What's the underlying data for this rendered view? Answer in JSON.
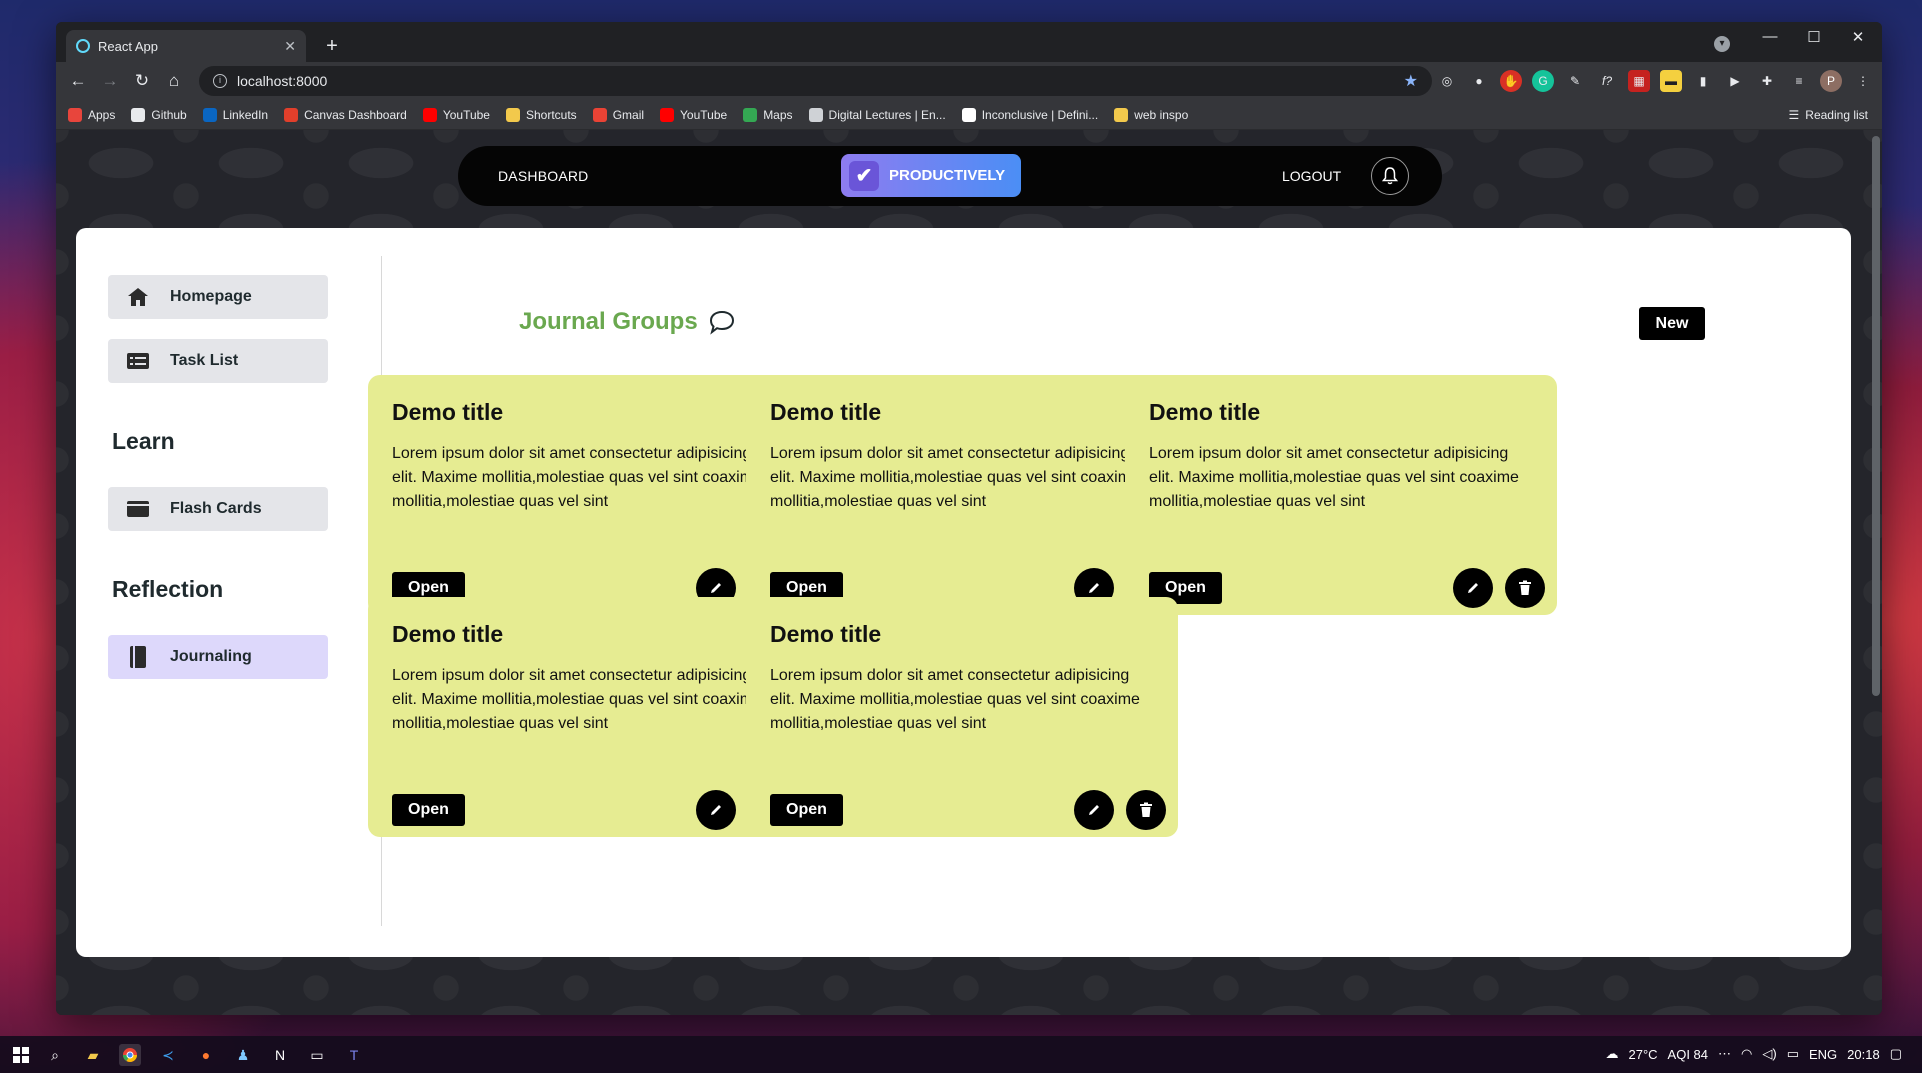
{
  "browser": {
    "tab_title": "React App",
    "new_tab_label": "+",
    "url": "localhost:8000",
    "bookmarks": [
      {
        "label": "Apps",
        "color": "#e8453c"
      },
      {
        "label": "Github",
        "color": "#e8eaed"
      },
      {
        "label": "LinkedIn",
        "color": "#0a66c2"
      },
      {
        "label": "Canvas Dashboard",
        "color": "#e13f2b"
      },
      {
        "label": "YouTube",
        "color": "#ff0000"
      },
      {
        "label": "Shortcuts",
        "color": "#f2c94c"
      },
      {
        "label": "Gmail",
        "color": "#ea4335"
      },
      {
        "label": "YouTube",
        "color": "#ff0000"
      },
      {
        "label": "Maps",
        "color": "#34a853"
      },
      {
        "label": "Digital Lectures | En...",
        "color": "#cfd2d6"
      },
      {
        "label": "Inconclusive | Defini...",
        "color": "#ffffff"
      },
      {
        "label": "web inspo",
        "color": "#f2c94c"
      }
    ],
    "reading_list": "Reading list",
    "profile_initial": "P"
  },
  "nav": {
    "dashboard": "DASHBOARD",
    "brand": "PRODUCTIVELY",
    "logout": "LOGOUT"
  },
  "sidebar": {
    "items": [
      {
        "label": "Homepage",
        "icon": "home-icon"
      },
      {
        "label": "Task List",
        "icon": "list-icon"
      }
    ],
    "learn_heading": "Learn",
    "learn_items": [
      {
        "label": "Flash Cards",
        "icon": "card-icon"
      }
    ],
    "reflection_heading": "Reflection",
    "reflection_items": [
      {
        "label": "Journaling",
        "icon": "journal-icon",
        "active": true
      }
    ]
  },
  "main": {
    "title": "Journal Groups",
    "new_button": "New",
    "cards": [
      {
        "title": "Demo title",
        "body": "Lorem ipsum dolor sit amet consectetur adipisicing elit. Maxime mollitia,molestiae quas vel sint coaxime mollitia,molestiae quas vel sint",
        "open_label": "Open"
      },
      {
        "title": "Demo title",
        "body": "Lorem ipsum dolor sit amet consectetur adipisicing elit. Maxime mollitia,molestiae quas vel sint coaxime mollitia,molestiae quas vel sint",
        "open_label": "Open"
      },
      {
        "title": "Demo title",
        "body": "Lorem ipsum dolor sit amet consectetur adipisicing elit. Maxime mollitia,molestiae quas vel sint coaxime mollitia,molestiae quas vel sint",
        "open_label": "Open"
      },
      {
        "title": "Demo title",
        "body": "Lorem ipsum dolor sit amet consectetur adipisicing elit. Maxime mollitia,molestiae quas vel sint coaxime mollitia,molestiae quas vel sint",
        "open_label": "Open"
      },
      {
        "title": "Demo title",
        "body": "Lorem ipsum dolor sit amet consectetur adipisicing elit. Maxime mollitia,molestiae quas vel sint coaxime mollitia,molestiae quas vel sint",
        "open_label": "Open"
      }
    ]
  },
  "taskbar": {
    "weather": "27°C",
    "aqi": "AQI 84",
    "language": "ENG",
    "time": "20:18"
  },
  "colors": {
    "card_bg": "#e6ec92",
    "title_green": "#6aa84f",
    "active_item": "#ddd8fb",
    "brand_gradient_start": "#8e7cf0",
    "brand_gradient_end": "#4b8ef5"
  }
}
